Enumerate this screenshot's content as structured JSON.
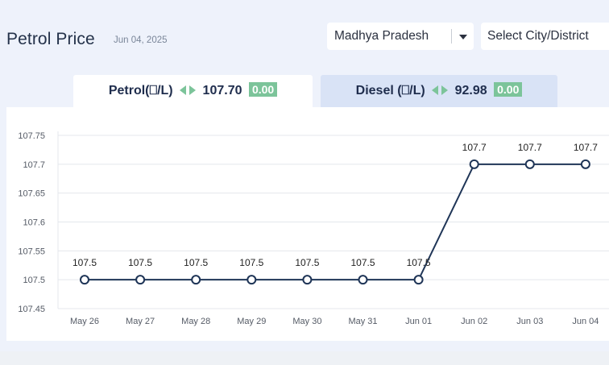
{
  "header": {
    "title": "Petrol Price",
    "date": "Jun 04, 2025"
  },
  "filters": {
    "state_value": "Madhya Pradesh",
    "city_placeholder": "Select City/District"
  },
  "tabs": [
    {
      "label": "Petrol(⎕/L)",
      "price": "107.70",
      "change": "0.00",
      "active": true
    },
    {
      "label": "Diesel (⎕/L)",
      "price": "92.98",
      "change": "0.00",
      "active": false
    }
  ],
  "colors": {
    "line": "#1f3557",
    "grid": "#e4e7ec",
    "badge": "#7cc49a",
    "arrow": "#7cc49a",
    "active_tab": "#ffffff",
    "inactive_tab": "#d9e3f6"
  },
  "chart_data": {
    "type": "line",
    "title": "",
    "xlabel": "",
    "ylabel": "",
    "categories": [
      "May 26",
      "May 27",
      "May 28",
      "May 29",
      "May 30",
      "May 31",
      "Jun 01",
      "Jun 02",
      "Jun 03",
      "Jun 04"
    ],
    "series": [
      {
        "values": [
          107.5,
          107.5,
          107.5,
          107.5,
          107.5,
          107.5,
          107.5,
          107.7,
          107.7,
          107.7
        ],
        "labels": [
          "107.5",
          "107.5",
          "107.5",
          "107.5",
          "107.5",
          "107.5",
          "107.5",
          "107.7",
          "107.7",
          "107.7"
        ]
      }
    ],
    "ylim": [
      107.45,
      107.75
    ],
    "yticks": [
      "107.75",
      "107.7",
      "107.65",
      "107.6",
      "107.55",
      "107.5",
      "107.45"
    ],
    "grid": true,
    "legend": "none"
  }
}
